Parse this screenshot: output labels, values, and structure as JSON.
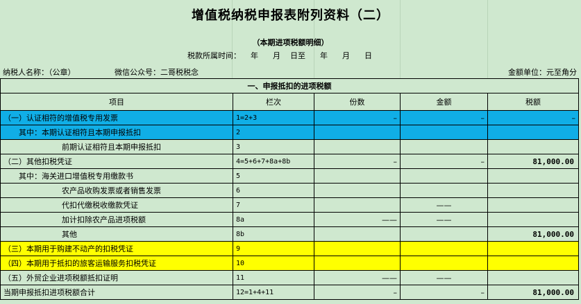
{
  "title": "增值税纳税申报表附列资料（二）",
  "subtitle": "（本期进项税额明细）",
  "period": {
    "label": "税款所属时间：",
    "year1": "年",
    "month1": "月",
    "day_to": "日至",
    "year2": "年",
    "month2": "月",
    "day2": "日"
  },
  "taxpayer_label": "纳税人名称：（公章）",
  "wechat_label": "微信公众号：二哥税税念",
  "unit_label": "金额单位：元至角分",
  "section_title": "一、申报抵扣的进项税额",
  "columns": [
    "项目",
    "栏次",
    "份数",
    "金额",
    "税额"
  ],
  "rows": [
    {
      "item": "（一）认证相符的增值税专用发票",
      "code": "1=2+3",
      "count": "–",
      "amount": "–",
      "tax": "–"
    },
    {
      "item": "其中：本期认证相符且本期申报抵扣",
      "code": "2",
      "count": "",
      "amount": "",
      "tax": ""
    },
    {
      "item": "前期认证相符且本期申报抵扣",
      "code": "3",
      "count": "",
      "amount": "",
      "tax": ""
    },
    {
      "item": "（二）其他扣税凭证",
      "code": "4=5+6+7+8a+8b",
      "count": "–",
      "amount": "–",
      "tax": "81,000.00"
    },
    {
      "item": "其中：海关进口增值税专用缴款书",
      "code": "5",
      "count": "",
      "amount": "",
      "tax": ""
    },
    {
      "item": "农产品收购发票或者销售发票",
      "code": "6",
      "count": "",
      "amount": "",
      "tax": ""
    },
    {
      "item": "代扣代缴税收缴款凭证",
      "code": "7",
      "count": "",
      "amount": "——",
      "tax": ""
    },
    {
      "item": "加计扣除农产品进项税额",
      "code": "8a",
      "count": "——",
      "amount": "——",
      "tax": ""
    },
    {
      "item": "其他",
      "code": "8b",
      "count": "",
      "amount": "",
      "tax": "81,000.00"
    },
    {
      "item": "（三）本期用于购建不动产的扣税凭证",
      "code": "9",
      "count": "",
      "amount": "",
      "tax": ""
    },
    {
      "item": "（四）本期用于抵扣的旅客运输服务扣税凭证",
      "code": "10",
      "count": "",
      "amount": "",
      "tax": ""
    },
    {
      "item": "（五）外贸企业进项税额抵扣证明",
      "code": "11",
      "count": "——",
      "amount": "——",
      "tax": ""
    },
    {
      "item": "当期申报抵扣进项税额合计",
      "code": "12=1+4+11",
      "count": "–",
      "amount": "–",
      "tax": "81,000.00"
    }
  ],
  "colors": {
    "background": "#cfe8cf",
    "blue_highlight": "#10aee6",
    "yellow_highlight": "#ffff00"
  }
}
